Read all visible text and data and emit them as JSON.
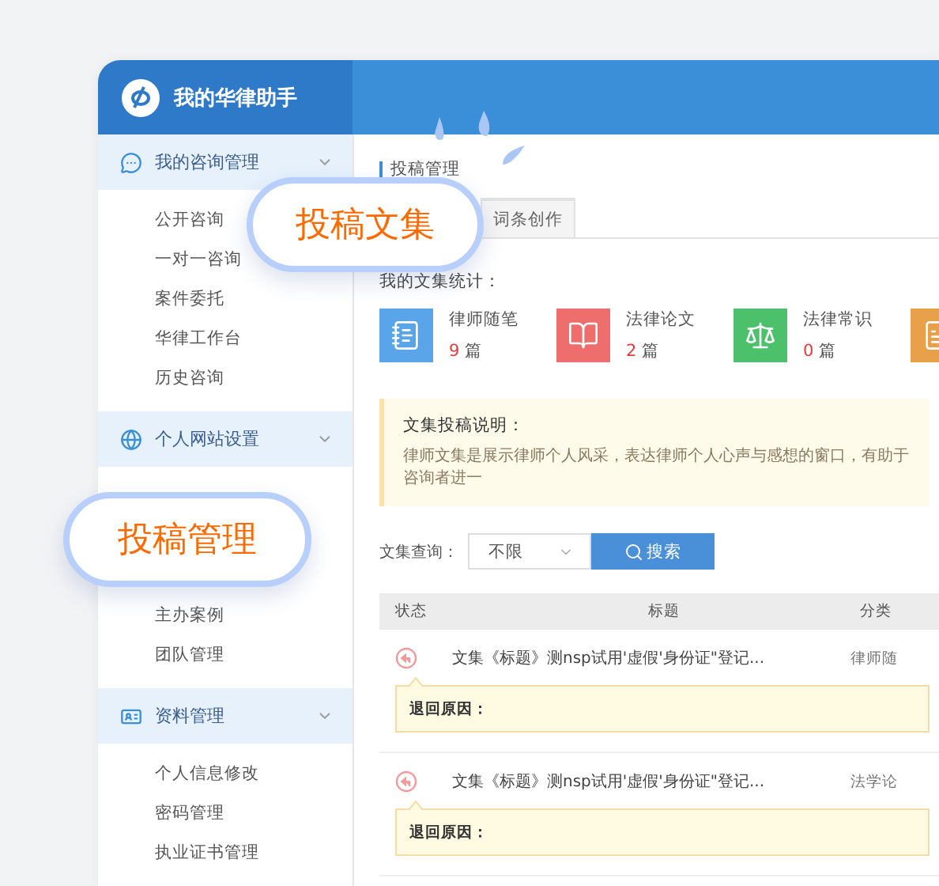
{
  "brand": {
    "title": "我的华律助手"
  },
  "sidebar": {
    "groups": [
      {
        "kind": "chat",
        "title": "我的咨询管理",
        "expanded": true,
        "items": [
          "公开咨询",
          "一对一咨询",
          "案件委托",
          "华律工作台",
          "历史咨询"
        ]
      },
      {
        "kind": "globe",
        "title": "个人网站设置",
        "expanded": true,
        "items": [
          "主办案例",
          "团队管理"
        ]
      },
      {
        "kind": "card",
        "title": "资料管理",
        "expanded": true,
        "items": [
          "个人信息修改",
          "密码管理",
          "执业证书管理"
        ]
      }
    ]
  },
  "breadcrumb": "投稿管理",
  "tabs": [
    {
      "label": "词条创作",
      "selected": false
    }
  ],
  "stats": {
    "title": "我的文集统计：",
    "items": [
      {
        "kind": "notebook",
        "label": "律师随笔",
        "count": "9",
        "unit": "篇",
        "color": "#5aa5ea"
      },
      {
        "kind": "book",
        "label": "法律论文",
        "count": "2",
        "unit": "篇",
        "color": "#ee6e6e"
      },
      {
        "kind": "scale",
        "label": "法律常识",
        "count": "0",
        "unit": "篇",
        "color": "#4cc06a"
      },
      {
        "kind": "document",
        "color": "#e8a04a"
      }
    ]
  },
  "notice": {
    "title": "文集投稿说明：",
    "text": "律师文集是展示律师个人风采，表达律师个人心声与感想的窗口，有助于咨询者进一"
  },
  "search": {
    "label": "文集查询：",
    "select": "不限",
    "button": "搜索"
  },
  "table": {
    "columns": [
      "状态",
      "标题",
      "分类"
    ],
    "rows": [
      {
        "kind": "returned",
        "title": "文集《标题》测nsp试用'虚假'身份证\"登记...",
        "category": "律师随",
        "reason_label": "退回原因："
      },
      {
        "kind": "returned",
        "title": "文集《标题》测nsp试用'虚假'身份证\"登记...",
        "category": "法学论",
        "reason_label": "退回原因："
      }
    ]
  },
  "callouts": [
    "投稿文集",
    "投稿管理"
  ]
}
